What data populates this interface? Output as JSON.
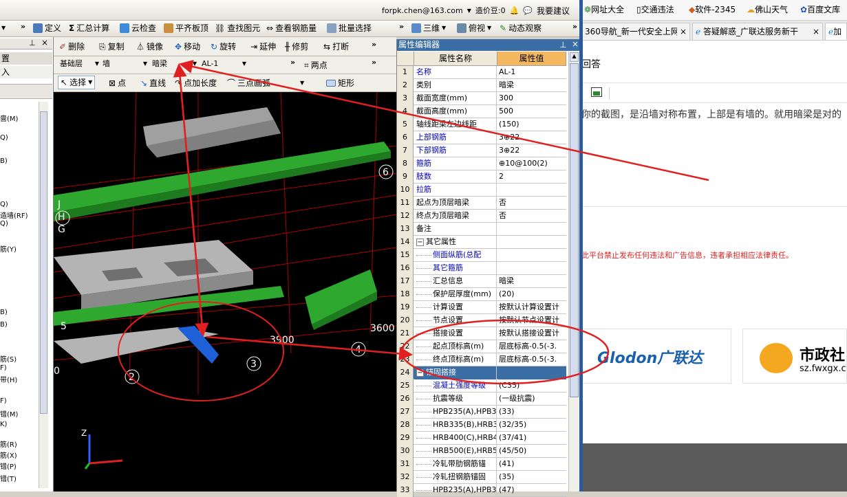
{
  "top_bar": {
    "email": "forpk.chen@163.com",
    "coins": "造价豆:0",
    "feedback": "我要建议"
  },
  "toolbar1": {
    "define": "定义",
    "summary_calc": "汇总计算",
    "cloud_check": "云检查",
    "level_slab": "平齐板顶",
    "find_elem": "查找图元",
    "view_rebar": "查看钢筋量",
    "batch_select": "批量选择",
    "view_3d": "三维",
    "view_top": "俯视",
    "dynamic_view": "动态观察"
  },
  "toolbar2": {
    "delete": "删除",
    "copy": "复制",
    "mirror": "镜像",
    "move": "移动",
    "rotate": "旋转",
    "extend": "延伸",
    "trim": "修剪",
    "break": "打断"
  },
  "toolbar3": {
    "floor": "基础层",
    "category": "墙",
    "type": "暗梁",
    "name": "AL-1",
    "two_points": "两点"
  },
  "toolbar4": {
    "select": "选择",
    "point": "点",
    "line": "直线",
    "point_len": "点加长度",
    "arc": "三点画弧",
    "rect": "矩形"
  },
  "left_panel": {
    "header": "置",
    "sub": "入",
    "items": [
      "啬(M)",
      "Q)",
      "B)",
      "Q)",
      "造墙(RF)",
      "Q)",
      "筋(Y)",
      "B)",
      "B)",
      "筋(S)",
      "F)",
      "带(H)",
      "F)",
      "错(M)",
      "K)",
      "筋(R)",
      "筋(X)",
      "错(P)",
      "错(T)"
    ]
  },
  "viewport": {
    "labels": [
      "6",
      "J",
      "H",
      "G",
      "3900",
      "3600",
      "4",
      "3",
      "2",
      "5",
      "0"
    ],
    "axis_z": "Z"
  },
  "property_editor": {
    "title": "属性编辑器",
    "col_name": "属性名称",
    "col_value": "属性值",
    "rows": [
      {
        "n": "1",
        "name": "名称",
        "value": "AL-1",
        "blue": true
      },
      {
        "n": "2",
        "name": "类别",
        "value": "暗梁",
        "blue": false
      },
      {
        "n": "3",
        "name": "截面宽度(mm)",
        "value": "300",
        "blue": false
      },
      {
        "n": "4",
        "name": "截面高度(mm)",
        "value": "500",
        "blue": false
      },
      {
        "n": "5",
        "name": "轴线距梁左边线距",
        "value": "(150)",
        "blue": false
      },
      {
        "n": "6",
        "name": "上部钢筋",
        "value": "3⊕22",
        "blue": true
      },
      {
        "n": "7",
        "name": "下部钢筋",
        "value": "3⊕22",
        "blue": true
      },
      {
        "n": "8",
        "name": "箍筋",
        "value": "⊕10@100(2)",
        "blue": true
      },
      {
        "n": "9",
        "name": "肢数",
        "value": "2",
        "blue": true
      },
      {
        "n": "10",
        "name": "拉筋",
        "value": "",
        "blue": true
      },
      {
        "n": "11",
        "name": "起点为顶层暗梁",
        "value": "否",
        "blue": false
      },
      {
        "n": "12",
        "name": "终点为顶层暗梁",
        "value": "否",
        "blue": false
      },
      {
        "n": "13",
        "name": "备注",
        "value": "",
        "blue": false
      },
      {
        "n": "14",
        "name": "其它属性",
        "value": "",
        "blue": false,
        "group": true
      },
      {
        "n": "15",
        "name": "侧面纵筋(总配",
        "value": "",
        "blue": true,
        "indent": true
      },
      {
        "n": "16",
        "name": "其它箍筋",
        "value": "",
        "blue": true,
        "indent": true
      },
      {
        "n": "17",
        "name": "汇总信息",
        "value": "暗梁",
        "blue": false,
        "indent": true
      },
      {
        "n": "18",
        "name": "保护层厚度(mm)",
        "value": "(20)",
        "blue": false,
        "indent": true
      },
      {
        "n": "19",
        "name": "计算设置",
        "value": "按默认计算设置计",
        "blue": false,
        "indent": true
      },
      {
        "n": "20",
        "name": "节点设置",
        "value": "按默认节点设置计",
        "blue": false,
        "indent": true
      },
      {
        "n": "21",
        "name": "搭接设置",
        "value": "按默认搭接设置计",
        "blue": false,
        "indent": true
      },
      {
        "n": "22",
        "name": "起点顶标高(m)",
        "value": "层底标高-0.5(-3.",
        "blue": false,
        "indent": true
      },
      {
        "n": "23",
        "name": "终点顶标高(m)",
        "value": "层底标高-0.5(-3.",
        "blue": false,
        "indent": true
      },
      {
        "n": "24",
        "name": "锚固搭接",
        "value": "",
        "blue": false,
        "group": true,
        "selected": true
      },
      {
        "n": "25",
        "name": "混凝土强度等级",
        "value": "(C35)",
        "blue": true,
        "indent": true
      },
      {
        "n": "26",
        "name": "抗震等级",
        "value": "(一级抗震)",
        "blue": false,
        "indent": true
      },
      {
        "n": "27",
        "name": "HPB235(A),HPB3",
        "value": "(33)",
        "blue": false,
        "indent": true
      },
      {
        "n": "28",
        "name": "HRB335(B),HRB3",
        "value": "(32/35)",
        "blue": false,
        "indent": true
      },
      {
        "n": "29",
        "name": "HRB400(C),HRB4",
        "value": "(37/41)",
        "blue": false,
        "indent": true
      },
      {
        "n": "30",
        "name": "HRB500(E),HRB5",
        "value": "(45/50)",
        "blue": false,
        "indent": true
      },
      {
        "n": "31",
        "name": "冷轧带肋钢筋锚",
        "value": "(41)",
        "blue": false,
        "indent": true
      },
      {
        "n": "32",
        "name": "冷轧扭钢筋锚固",
        "value": "(35)",
        "blue": false,
        "indent": true
      },
      {
        "n": "33",
        "name": "HPB235(A),HPB3",
        "value": "(47)",
        "blue": false,
        "indent": true
      }
    ]
  },
  "browser": {
    "bookmarks": [
      "网址大全",
      "交通违法",
      "软件-2345",
      "佛山天气",
      "百度文库"
    ],
    "tabs": [
      "360导航_新一代安全上网导",
      "答疑解惑_广联达服务新干",
      "加"
    ],
    "answer_label": "回答",
    "answer_text": "你的截图，是沿墙对称布置，上部是有墙的。就用暗梁是对的",
    "warning": "此平台禁止发布任何违法和广告信息，违者承担相应法律责任。",
    "ad1_brand": "Glodon广联达",
    "ad2_title": "市政社",
    "ad2_url": "sz.fwxgx.c"
  }
}
